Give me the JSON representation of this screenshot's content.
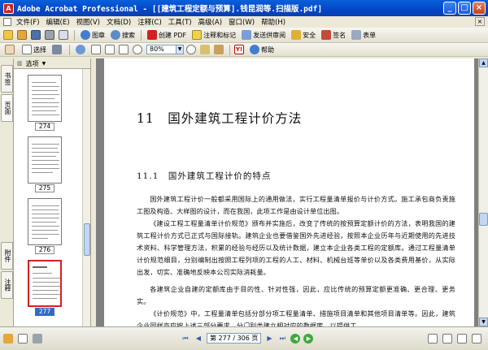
{
  "window": {
    "title": "Adobe Acrobat Professional - [[建筑工程定额与预算].钱昆润等.扫描版.pdf]",
    "minimize": "_",
    "maximize": "□",
    "close": "×"
  },
  "menu": {
    "items": [
      "文件(F)",
      "编辑(E)",
      "视图(V)",
      "文档(D)",
      "注释(C)",
      "工具(T)",
      "高级(A)",
      "窗口(W)",
      "帮助(H)"
    ],
    "doc_close": "×"
  },
  "toolbar1": {
    "stamp": "图章",
    "search": "搜索",
    "create_pdf": "创建 PDF",
    "comment": "注释和标记",
    "send_review": "发送供审阅",
    "security": "安全",
    "sign": "签名",
    "forms": "表单"
  },
  "toolbar2": {
    "select": "选择",
    "zoom_value": "80%",
    "help": "帮助"
  },
  "nav_tabs": {
    "bookmarks": "书签",
    "pages": "页面",
    "attachments": "附件",
    "comments": "注释"
  },
  "thumbnails": {
    "options_label": "选项",
    "pages": [
      {
        "number": "274",
        "selected": false
      },
      {
        "number": "275",
        "selected": false
      },
      {
        "number": "276",
        "selected": false
      },
      {
        "number": "277",
        "selected": true
      }
    ]
  },
  "document": {
    "chapter_title": "11　国外建筑工程计价方法",
    "section_title": "11.1　国外建筑工程计价的特点",
    "paragraphs": [
      "国外建筑工程计价一般都采用国际上的通用做法，实行工程量清单报价与计价方式。施工承包商负责施工图及构造、大样图的设计，而在我国，此项工作是由设计单位出图。",
      "《建设工程工程量清单计价规范》颁布并实施后，改变了传统的按预算定额计价的方法，表明我国的建筑工程计价方式已正式与国际接轨。建筑企业也要借鉴国外先进经验，按照本企业历年与近期使用的先进技术资料、科学管理方法，积累的经验与经历以及统计数据，建立本企业各类工程的定额库。通过工程量清单计价规范细目，分别编制出按照工程列项的工程的人工、材料、机械台班等单价以及各类费用基价，从实际出发，切实、准确地反映本公司实际消耗量。",
      "各建筑企业自建的定额库由于目的性、针对性强，因此，应比传统的预算定额更准确、更合理、更务实。",
      "《计价规范》中，工程量清单包括分部分项工程量清单、措施项目清单和其他项目清单等。因此，建筑企业同样亦应按上述三部分要求，分门别类建立相对应的数据库，以提供工"
    ]
  },
  "statusbar": {
    "page_display": "第 277 / 306 页"
  }
}
